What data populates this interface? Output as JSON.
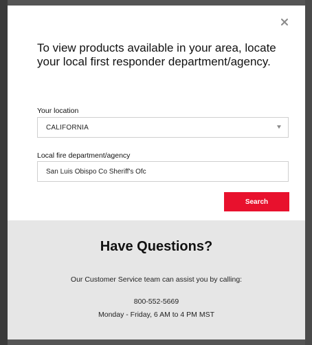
{
  "modal": {
    "heading": "To view products available in your area, locate your local first responder department/agency.",
    "close_label": "×"
  },
  "form": {
    "location_label": "Your location",
    "location_value": "CALIFORNIA",
    "agency_label": "Local fire department/agency",
    "agency_value": "San Luis Obispo Co Sheriff's Ofc",
    "search_label": "Search"
  },
  "help": {
    "title": "Have Questions?",
    "subtitle": "Our Customer Service team can assist you by calling:",
    "phone": "800-552-5669",
    "hours": "Monday - Friday, 6 AM to 4 PM MST"
  },
  "colors": {
    "accent": "#e8112d",
    "help_background": "#e6e6e6"
  },
  "icons": {
    "close": "close-icon",
    "dropdown": "chevron-down-icon"
  }
}
